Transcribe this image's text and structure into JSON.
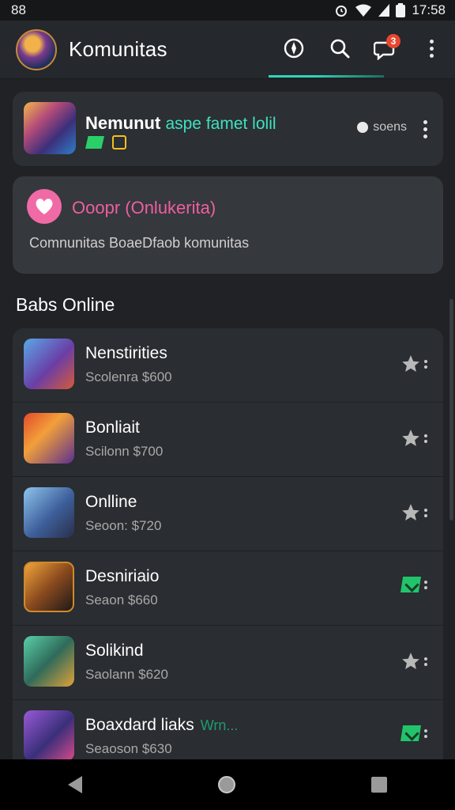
{
  "status_bar": {
    "left_text": "88",
    "time": "17:58"
  },
  "app_bar": {
    "title": "Komunitas",
    "notification_count": "3"
  },
  "featured": {
    "title": "Nemunut",
    "title_accent": "aspe famet lolil",
    "meta_label": "soens"
  },
  "invite": {
    "title": "Ooopr (Onlukerita)",
    "description": "Comnunitas BoaeDfaob komunitas"
  },
  "section": {
    "title": "Babs Online"
  },
  "list_items": [
    {
      "title": "Nenstirities",
      "accent": "",
      "subtitle": "Scolenra $600",
      "action": "star"
    },
    {
      "title": "Bonliait",
      "accent": "",
      "subtitle": "Scilonn $700",
      "action": "star"
    },
    {
      "title": "Onlline",
      "accent": "",
      "subtitle": "Seoon: $720",
      "action": "star"
    },
    {
      "title": "Desniriaio",
      "accent": "",
      "subtitle": "Seaon $660",
      "action": "check"
    },
    {
      "title": "Solikind",
      "accent": "",
      "subtitle": "Saolann $620",
      "action": "star"
    },
    {
      "title": "Boaxdard liaks",
      "accent": "Wrn...",
      "subtitle": "Seaoson $630",
      "action": "check"
    }
  ],
  "colors": {
    "accent": "#2fd5b8",
    "pink": "#ee5fa0",
    "badge": "#e8472f",
    "success": "#22c46b"
  }
}
